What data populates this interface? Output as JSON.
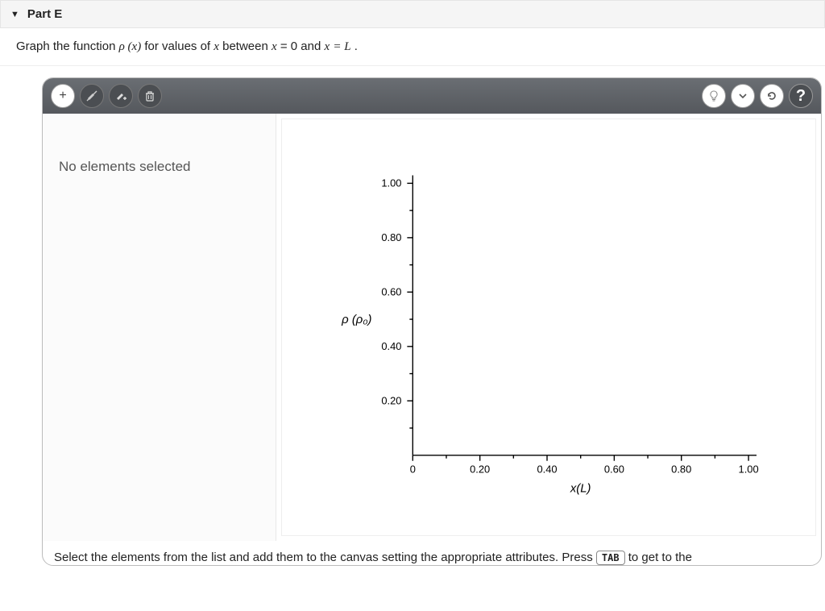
{
  "part": {
    "label": "Part E"
  },
  "instruction": {
    "pre": "Graph the function ",
    "fn": "ρ (x)",
    "mid1": " for values of ",
    "var1": "x",
    "mid2": " between ",
    "eq1a": "x",
    "eq1b": " = 0",
    "mid3": " and ",
    "eq2a": "x",
    "eq2b": " = L",
    "end": "."
  },
  "toolbar": {
    "add": "+",
    "no_edit": "✕",
    "point_tool": "✦",
    "trash": "🗑",
    "hint": "💡",
    "down": "⌄",
    "reset": "↻",
    "help": "?"
  },
  "side_panel": {
    "message": "No elements selected"
  },
  "chart_data": {
    "type": "scatter",
    "series": [],
    "title": "",
    "xlabel": "x(L)",
    "ylabel": "ρ (ρ₀)",
    "xlim": [
      0,
      1.0
    ],
    "ylim": [
      0,
      1.0
    ],
    "xticks": [
      0,
      0.2,
      0.4,
      0.6,
      0.8,
      1.0
    ],
    "yticks": [
      0.2,
      0.4,
      0.6,
      0.8,
      1.0
    ],
    "xtick_labels": [
      "0",
      "0.20",
      "0.40",
      "0.60",
      "0.80",
      "1.00"
    ],
    "ytick_labels": [
      "0.20",
      "0.40",
      "0.60",
      "0.80",
      "1.00"
    ]
  },
  "footer": {
    "text_pre": "Select the elements from the list and add them to the canvas setting the appropriate attributes. Press ",
    "key": "TAB",
    "text_post": " to get to the"
  }
}
